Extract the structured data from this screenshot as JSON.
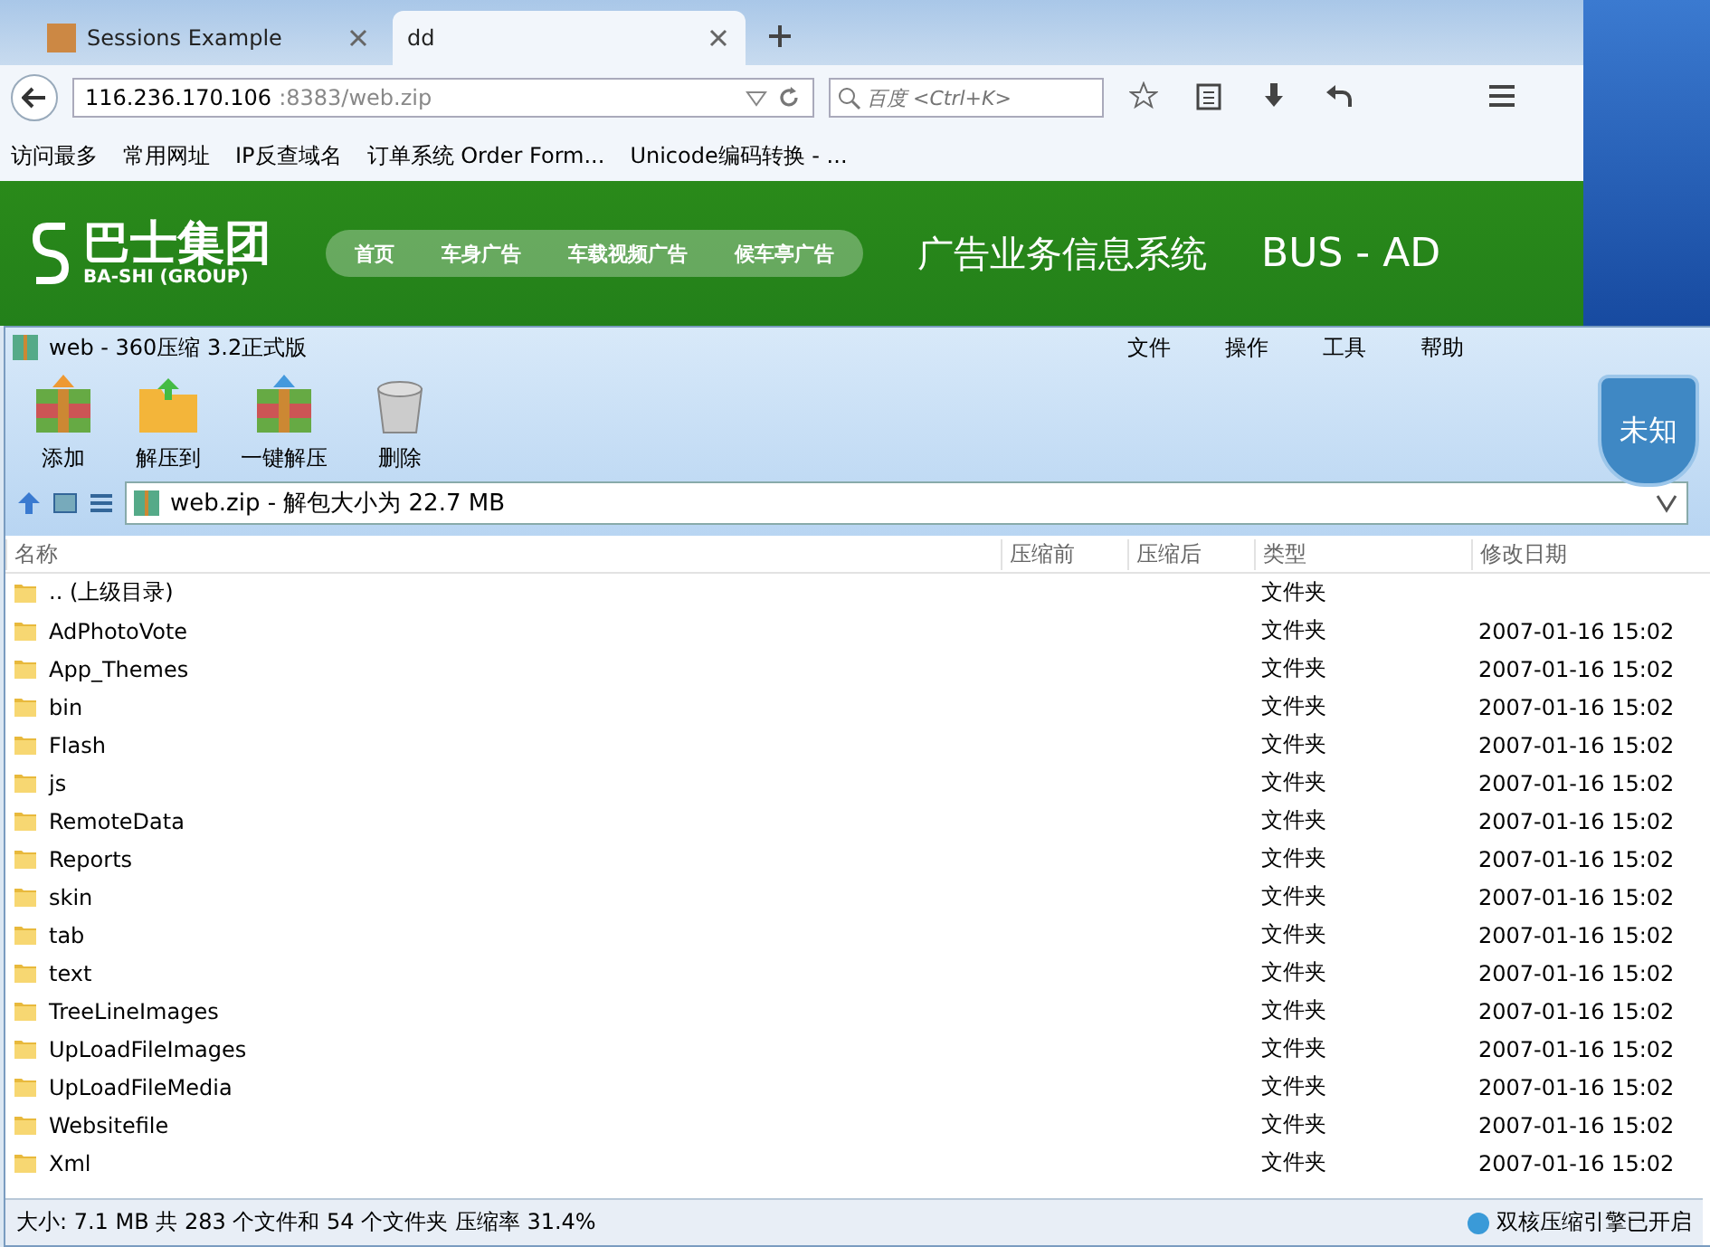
{
  "browser": {
    "tabs": [
      {
        "label": "Sessions Example",
        "selected": false
      },
      {
        "label": "dd",
        "selected": true
      }
    ],
    "url": {
      "host": "116.236.170.106",
      "rest": ":8383/web.zip"
    },
    "search": {
      "placeholder": "百度 <Ctrl+K>"
    },
    "bookmarks": [
      "访问最多",
      "常用网址",
      "IP反查域名",
      "订单系统 Order Form...",
      "Unicode编码转换 - ..."
    ]
  },
  "site": {
    "logo_cn": "巴士集团",
    "logo_en": "BA-SHI (GROUP)",
    "nav": [
      "首页",
      "车身广告",
      "车载视频广告",
      "候车亭广告"
    ],
    "title": "广告业务信息系统",
    "title_en": "BUS - AD"
  },
  "archiver": {
    "title": "web - 360压缩 3.2正式版",
    "menu": [
      "文件",
      "操作",
      "工具",
      "帮助"
    ],
    "tools": [
      "添加",
      "解压到",
      "一键解压",
      "删除"
    ],
    "badge": "未知",
    "path": "web.zip - 解包大小为 22.7 MB",
    "columns": [
      "名称",
      "压缩前",
      "压缩后",
      "类型",
      "修改日期"
    ],
    "rows": [
      {
        "name": ".. (上级目录)",
        "type": "文件夹"
      },
      {
        "name": "AdPhotoVote",
        "type": "文件夹",
        "date": "2007-01-16 15:02"
      },
      {
        "name": "App_Themes",
        "type": "文件夹",
        "date": "2007-01-16 15:02"
      },
      {
        "name": "bin",
        "type": "文件夹",
        "date": "2007-01-16 15:02"
      },
      {
        "name": "Flash",
        "type": "文件夹",
        "date": "2007-01-16 15:02"
      },
      {
        "name": "js",
        "type": "文件夹",
        "date": "2007-01-16 15:02"
      },
      {
        "name": "RemoteData",
        "type": "文件夹",
        "date": "2007-01-16 15:02"
      },
      {
        "name": "Reports",
        "type": "文件夹",
        "date": "2007-01-16 15:02"
      },
      {
        "name": "skin",
        "type": "文件夹",
        "date": "2007-01-16 15:02"
      },
      {
        "name": "tab",
        "type": "文件夹",
        "date": "2007-01-16 15:02"
      },
      {
        "name": "text",
        "type": "文件夹",
        "date": "2007-01-16 15:02"
      },
      {
        "name": "TreeLineImages",
        "type": "文件夹",
        "date": "2007-01-16 15:02"
      },
      {
        "name": "UpLoadFileImages",
        "type": "文件夹",
        "date": "2007-01-16 15:02"
      },
      {
        "name": "UpLoadFileMedia",
        "type": "文件夹",
        "date": "2007-01-16 15:02"
      },
      {
        "name": "Websitefile",
        "type": "文件夹",
        "date": "2007-01-16 15:02"
      },
      {
        "name": "Xml",
        "type": "文件夹",
        "date": "2007-01-16 15:02"
      }
    ],
    "status": "大小: 7.1 MB 共 283 个文件和 54 个文件夹 压缩率 31.4%",
    "engine": "双核压缩引擎已开启"
  }
}
